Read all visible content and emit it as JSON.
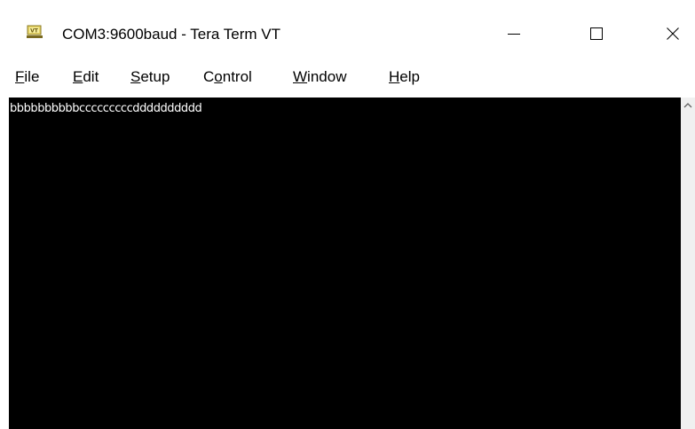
{
  "window": {
    "title": "COM3:9600baud - Tera Term VT",
    "icon": "tera-term-vt-icon",
    "buttons": {
      "minimize": "minimize-icon",
      "maximize": "maximize-icon",
      "close": "close-icon"
    }
  },
  "menu": {
    "file": {
      "mnemonic": "F",
      "rest": "ile"
    },
    "edit": {
      "mnemonic": "E",
      "rest": "dit"
    },
    "setup": {
      "mnemonic": "S",
      "rest": "etup"
    },
    "control": {
      "before": "C",
      "mnemonic": "o",
      "rest": "ntrol"
    },
    "window": {
      "mnemonic": "W",
      "rest": "indow"
    },
    "help": {
      "mnemonic": "H",
      "rest": "elp"
    }
  },
  "terminal": {
    "lines": [
      "bbbbbbbbbbcccccccccdddddddddd"
    ],
    "background": "#000000",
    "foreground": "#ffffff"
  },
  "scrollbar": {
    "up_icon": "scroll-up-arrow-icon"
  }
}
